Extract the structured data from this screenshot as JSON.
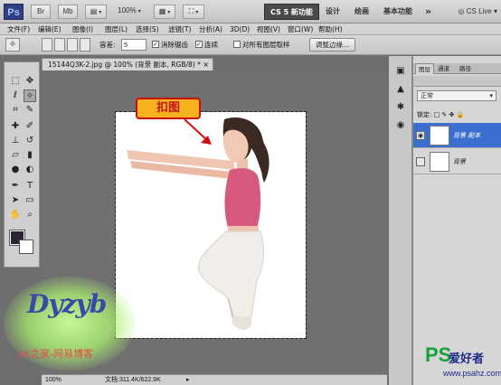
{
  "appbar": {
    "logo": "Ps",
    "zoom_label": "100%",
    "workspace_active": "CS 5 新功能",
    "workspace_items": [
      "设计",
      "绘画",
      "基本功能"
    ],
    "more_symbol": "»",
    "cs_live": "CS Live"
  },
  "menu": [
    "文件(F)",
    "编辑(E)",
    "图像(I)",
    "图层(L)",
    "选择(S)",
    "滤镜(T)",
    "分析(A)",
    "3D(D)",
    "视图(V)",
    "窗口(W)",
    "帮助(H)"
  ],
  "options": {
    "tolerance_label": "容差:",
    "tolerance_value": "5",
    "antialias_label": "消除锯齿",
    "contiguous_label": "连续",
    "sample_all_label": "对所有图层取样",
    "refine_edge_label": "调整边缘..."
  },
  "document": {
    "tab_title": "15144Q3K-2.jpg @ 100% (背景 副本, RGB/8) *",
    "zoom": "100%",
    "doc_size": "文档:311.4K/622.9K"
  },
  "callout": {
    "text": "扣图"
  },
  "layers_panel": {
    "tabs": [
      "图层",
      "通道",
      "路径"
    ],
    "blend_mode": "正常",
    "lock_label": "锁定:",
    "layers": [
      {
        "name": "背景 副本",
        "selected": true,
        "visible": true
      },
      {
        "name": "背景",
        "selected": false,
        "visible": false
      }
    ]
  },
  "watermarks": {
    "logo": "Dyzyb",
    "blog_text": "ok之家-网易博客",
    "ps_big": "PS",
    "ps_cn": "爱好者",
    "ps_url": "www.psahz.com"
  }
}
